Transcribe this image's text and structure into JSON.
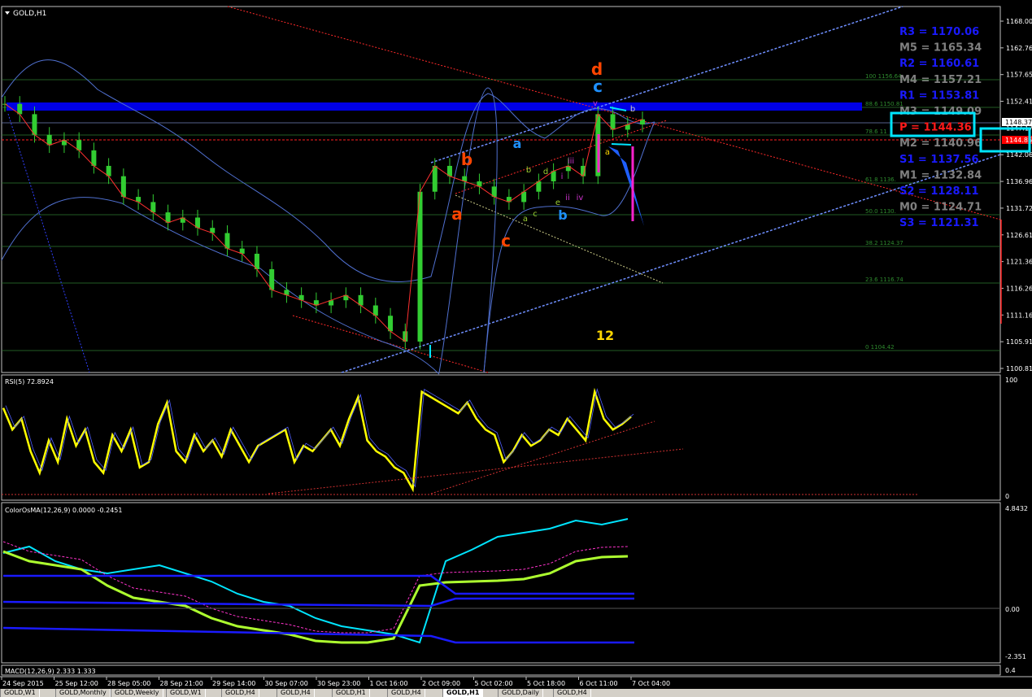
{
  "window": {
    "symbol_title": "GOLD,H1"
  },
  "price_axis": {
    "labels": [
      "1168.00",
      "1162.76",
      "1157.65",
      "1152.41",
      "1147.17",
      "1142.06",
      "1136.96",
      "1131.72",
      "1126.61",
      "1121.36",
      "1116.26",
      "1111.16",
      "1105.91",
      "1100.81"
    ],
    "current_price": "1148.37",
    "bid_price": "1144.86"
  },
  "time_axis": {
    "labels": [
      "24 Sep 2015",
      "25 Sep 12:00",
      "28 Sep 05:00",
      "28 Sep 21:00",
      "29 Sep 14:00",
      "30 Sep 07:00",
      "30 Sep 23:00",
      "1 Oct 16:00",
      "2 Oct 09:00",
      "5 Oct 02:00",
      "5 Oct 18:00",
      "6 Oct 11:00",
      "7 Oct 04:00"
    ]
  },
  "pivots": [
    {
      "label": "R3 = 1170.06",
      "color": "#1a1aff"
    },
    {
      "label": "M5 = 1165.34",
      "color": "#808080"
    },
    {
      "label": "R2 = 1160.61",
      "color": "#1a1aff"
    },
    {
      "label": "M4 = 1157.21",
      "color": "#808080"
    },
    {
      "label": "R1 = 1153.81",
      "color": "#1a1aff"
    },
    {
      "label": "M3 = 1149.09",
      "color": "#808080"
    },
    {
      "label": "P  = 1144.36",
      "color": "#ff1a1a"
    },
    {
      "label": "M2 = 1140.96",
      "color": "#808080"
    },
    {
      "label": "S1 = 1137.56",
      "color": "#1a1aff"
    },
    {
      "label": "M1 = 1132.84",
      "color": "#808080"
    },
    {
      "label": "S2 = 1128.11",
      "color": "#1a1aff"
    },
    {
      "label": "M0 = 1124.71",
      "color": "#808080"
    },
    {
      "label": "S3 = 1121.31",
      "color": "#1a1aff"
    }
  ],
  "fibo_levels": [
    "100 1156.64",
    "88.6 1150.81",
    "78.6 11",
    "61.8 1136.",
    "50.0 1130.",
    "38.2 1124.37",
    "23.6 1116.74",
    "0 1104.42"
  ],
  "wave_labels": [
    {
      "text": "d",
      "color": "#ff4500",
      "size": "big"
    },
    {
      "text": "c",
      "color": "#1e90ff",
      "size": "big"
    },
    {
      "text": "b",
      "color": "#ff4500",
      "size": "big"
    },
    {
      "text": "a",
      "color": "#ff4500",
      "size": "big"
    },
    {
      "text": "c",
      "color": "#ff4500",
      "size": "big"
    },
    {
      "text": "a",
      "color": "#1e90ff",
      "size": "med"
    },
    {
      "text": "b",
      "color": "#1e90ff",
      "size": "med"
    },
    {
      "text": "b",
      "color": "#9acd32",
      "size": "sm"
    },
    {
      "text": "d",
      "color": "#9acd32",
      "size": "sm"
    },
    {
      "text": "e",
      "color": "#9acd32",
      "size": "sm"
    },
    {
      "text": "c",
      "color": "#9acd32",
      "size": "sm"
    },
    {
      "text": "a",
      "color": "#9acd32",
      "size": "sm"
    },
    {
      "text": "iii",
      "color": "#cc33cc",
      "size": "sm"
    },
    {
      "text": "i",
      "color": "#cc33cc",
      "size": "sm"
    },
    {
      "text": "ii",
      "color": "#cc33cc",
      "size": "sm"
    },
    {
      "text": "iv",
      "color": "#cc33cc",
      "size": "sm"
    },
    {
      "text": "v",
      "color": "#cc33cc",
      "size": "sm"
    },
    {
      "text": "b",
      "color": "#c8c8c8",
      "size": "sm"
    },
    {
      "text": "a",
      "color": "#ffd700",
      "size": "sm"
    },
    {
      "text": "12",
      "color": "#ffd700",
      "size": "med"
    }
  ],
  "rsi": {
    "title": "RSI(5) 72.8924",
    "max_label": "100",
    "min_label": "0"
  },
  "osma": {
    "title": "ColorOsMA(12,26,9) 0.0000 -0.2451",
    "labels": [
      "4.8432",
      "0.00",
      "-2.351"
    ]
  },
  "macd": {
    "title": "MACD(12,26,9) 2.333 1.333",
    "right_label": "0.4"
  },
  "tabs": [
    "GOLD,W1",
    "GOLD,Monthly",
    "GOLD,Weekly",
    "GOLD,W1",
    "GOLD,H4",
    "GOLD,H4",
    "GOLD,H1",
    "GOLD,H4",
    "GOLD,H1",
    "GOLD,Daily",
    "GOLD,H4"
  ],
  "active_tab_index": 8,
  "colors": {
    "bull": "#32cd32",
    "bear": "#32cd32",
    "background": "#000000",
    "grid": "#808080",
    "pivot_box": "#00e5ff"
  },
  "chart_data": {
    "type": "candlestick",
    "title": "GOLD,H1",
    "ylim": [
      1100.81,
      1168.0
    ],
    "x_ticks": [
      "24 Sep 2015",
      "25 Sep 12:00",
      "28 Sep 05:00",
      "28 Sep 21:00",
      "29 Sep 14:00",
      "30 Sep 07:00",
      "30 Sep 23:00",
      "1 Oct 16:00",
      "2 Oct 09:00",
      "5 Oct 02:00",
      "5 Oct 18:00",
      "6 Oct 11:00",
      "7 Oct 04:00"
    ],
    "close_path": [
      1152,
      1150,
      1146,
      1144,
      1145,
      1143,
      1140,
      1138,
      1134,
      1133,
      1131,
      1129,
      1130,
      1128,
      1127,
      1124,
      1123,
      1120,
      1116,
      1115,
      1114,
      1113,
      1114,
      1115,
      1113,
      1111,
      1108,
      1106,
      1135,
      1140,
      1138,
      1137,
      1136,
      1134,
      1133,
      1135,
      1137,
      1139,
      1140,
      1138,
      1150,
      1147,
      1148,
      1149
    ]
  }
}
